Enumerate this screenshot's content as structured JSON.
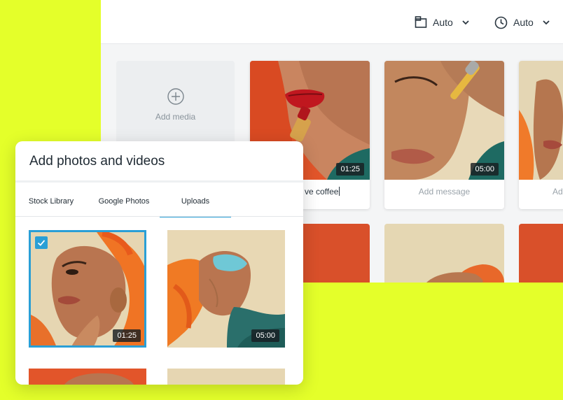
{
  "toolbar": {
    "layout_label": "Auto",
    "time_label": "Auto"
  },
  "grid": {
    "add_media_label": "Add media",
    "cards": [
      {
        "duration": "01:25",
        "message": "ve coffee"
      },
      {
        "duration": "05:00",
        "message": "Add message"
      },
      {
        "message": "Ad"
      }
    ]
  },
  "modal": {
    "title": "Add photos and videos",
    "tabs": [
      {
        "label": "Stock Library",
        "active": false
      },
      {
        "label": "Google Photos",
        "active": false
      },
      {
        "label": "Uploads",
        "active": true
      }
    ],
    "uploads": [
      {
        "duration": "01:25",
        "selected": true
      },
      {
        "duration": "05:00",
        "selected": false
      }
    ]
  },
  "colors": {
    "background": "#e4ff2a",
    "accent": "#2a9fd6",
    "photo_orange": "#e2552a"
  },
  "icons": [
    "layout-icon",
    "clock-icon",
    "chevron-down-icon",
    "plus-circle-icon",
    "check-icon"
  ]
}
